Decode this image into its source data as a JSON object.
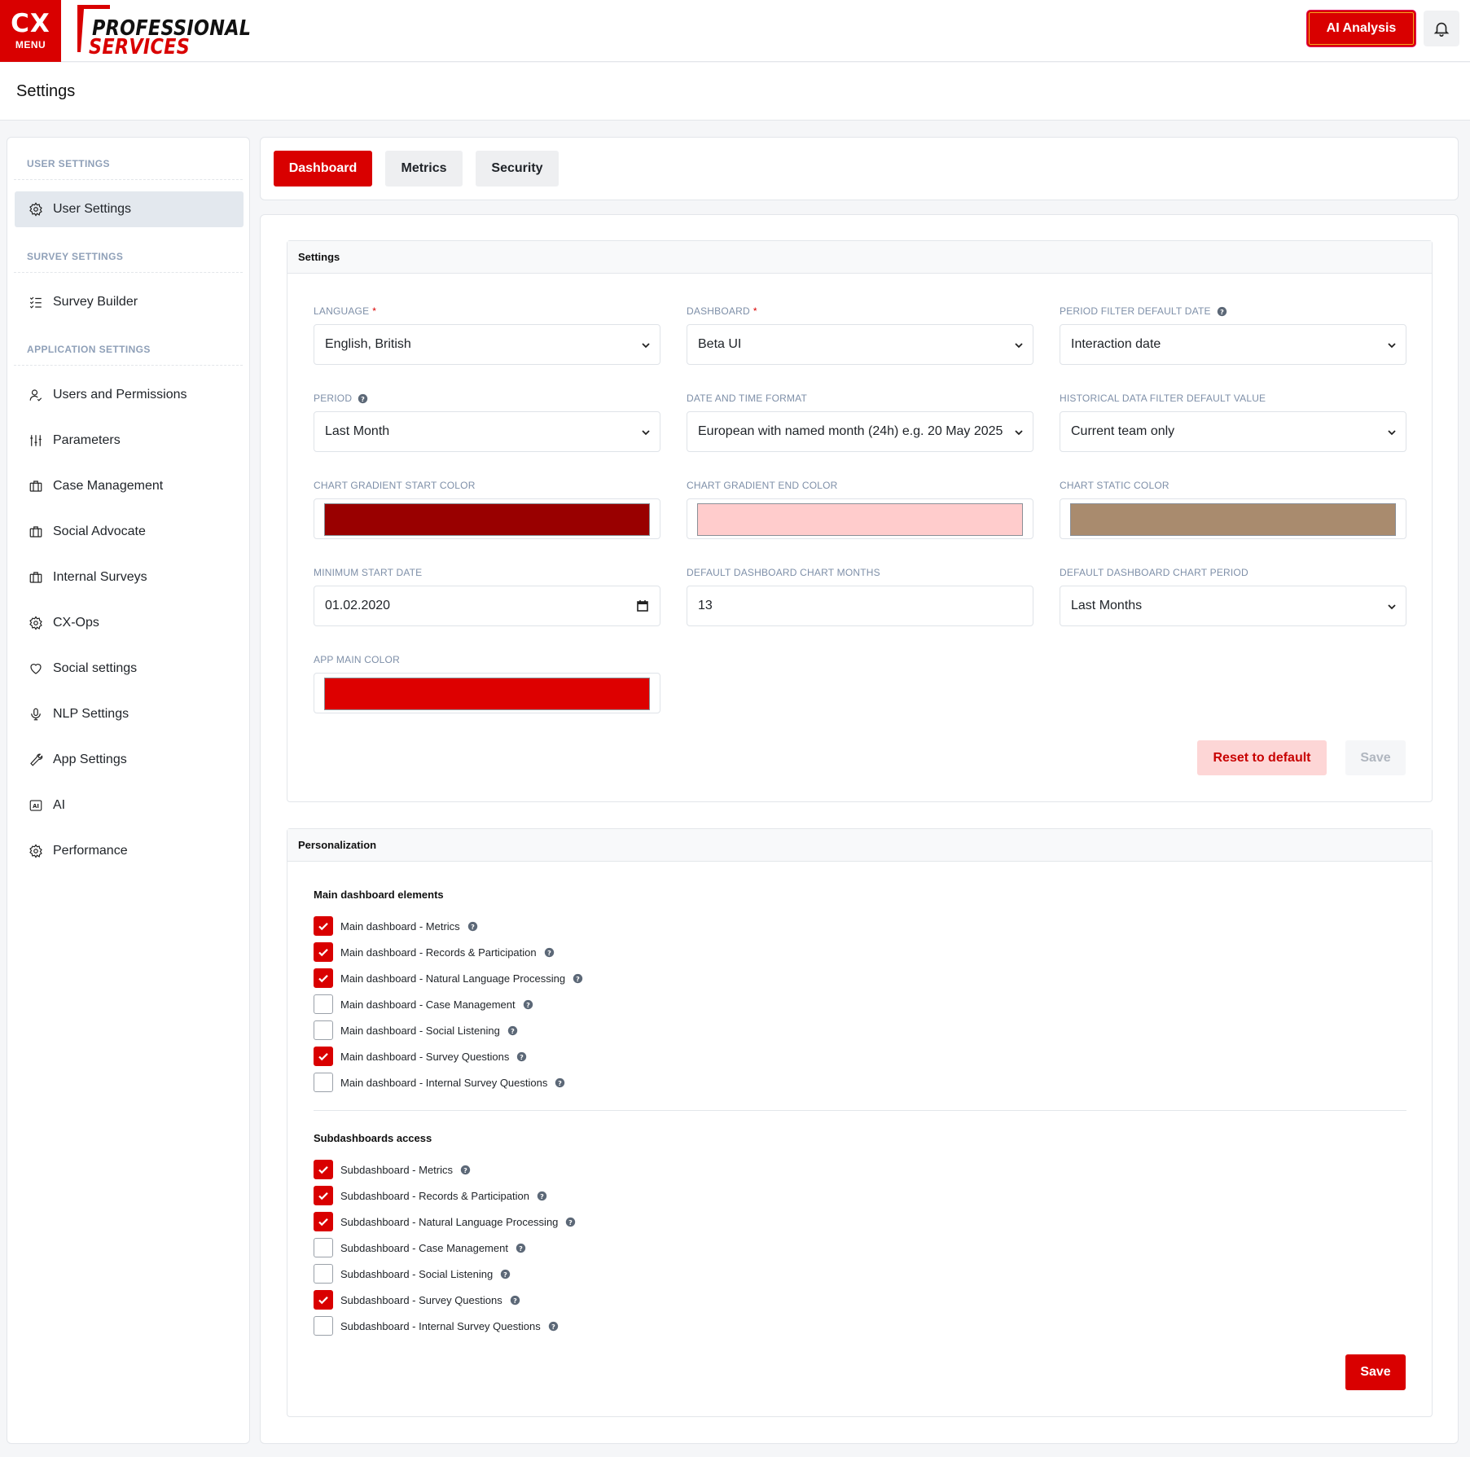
{
  "app": {
    "menu_logo_text": "CX",
    "menu_label": "MENU",
    "brand_line1": "PROFESSIONAL",
    "brand_line2": "SERVICES",
    "ai_button": "AI Analysis"
  },
  "page": {
    "title": "Settings"
  },
  "sidebar": {
    "sections": {
      "user": "USER SETTINGS",
      "survey": "SURVEY SETTINGS",
      "application": "APPLICATION SETTINGS"
    },
    "items": {
      "user_settings": "User Settings",
      "survey_builder": "Survey Builder",
      "users_permissions": "Users and Permissions",
      "parameters": "Parameters",
      "case_management": "Case Management",
      "social_advocate": "Social Advocate",
      "internal_surveys": "Internal Surveys",
      "cx_ops": "CX-Ops",
      "social_settings": "Social settings",
      "nlp_settings": "NLP Settings",
      "app_settings": "App Settings",
      "ai": "AI",
      "performance": "Performance"
    }
  },
  "tabs": {
    "dashboard": "Dashboard",
    "metrics": "Metrics",
    "security": "Security"
  },
  "settings_panel": {
    "title": "Settings",
    "language": {
      "label": "LANGUAGE",
      "value": "English, British"
    },
    "dashboard": {
      "label": "DASHBOARD",
      "value": "Beta UI"
    },
    "period_filter": {
      "label": "PERIOD FILTER DEFAULT DATE",
      "value": "Interaction date"
    },
    "period": {
      "label": "PERIOD",
      "value": "Last Month"
    },
    "date_format": {
      "label": "DATE AND TIME FORMAT",
      "value": "European with named month (24h) e.g. 20 May 2025"
    },
    "historical": {
      "label": "HISTORICAL DATA FILTER DEFAULT VALUE",
      "value": "Current team only"
    },
    "gradient_start": {
      "label": "CHART GRADIENT START COLOR",
      "color": "#990000"
    },
    "gradient_end": {
      "label": "CHART GRADIENT END COLOR",
      "color": "#ffcccc"
    },
    "static_color": {
      "label": "CHART STATIC COLOR",
      "color": "#a98b6e"
    },
    "min_start_date": {
      "label": "MINIMUM START DATE",
      "value": "01.02.2020"
    },
    "chart_months": {
      "label": "DEFAULT DASHBOARD CHART MONTHS",
      "value": "13"
    },
    "chart_period": {
      "label": "DEFAULT DASHBOARD CHART PERIOD",
      "value": "Last Months"
    },
    "app_main_color": {
      "label": "APP MAIN COLOR",
      "color": "#dd0000"
    },
    "reset_button": "Reset to default",
    "save_button": "Save"
  },
  "personalization": {
    "title": "Personalization",
    "main_title": "Main dashboard elements",
    "main_items": [
      {
        "label": "Main dashboard - Metrics",
        "checked": true
      },
      {
        "label": "Main dashboard - Records & Participation",
        "checked": true
      },
      {
        "label": "Main dashboard - Natural Language Processing",
        "checked": true
      },
      {
        "label": "Main dashboard - Case Management",
        "checked": false
      },
      {
        "label": "Main dashboard - Social Listening",
        "checked": false
      },
      {
        "label": "Main dashboard - Survey Questions",
        "checked": true
      },
      {
        "label": "Main dashboard - Internal Survey Questions",
        "checked": false
      }
    ],
    "sub_title": "Subdashboards access",
    "sub_items": [
      {
        "label": "Subdashboard - Metrics",
        "checked": true
      },
      {
        "label": "Subdashboard - Records & Participation",
        "checked": true
      },
      {
        "label": "Subdashboard - Natural Language Processing",
        "checked": true
      },
      {
        "label": "Subdashboard - Case Management",
        "checked": false
      },
      {
        "label": "Subdashboard - Social Listening",
        "checked": false
      },
      {
        "label": "Subdashboard - Survey Questions",
        "checked": true
      },
      {
        "label": "Subdashboard - Internal Survey Questions",
        "checked": false
      }
    ],
    "save_button": "Save"
  },
  "colors": {
    "brand": "#d90000"
  }
}
